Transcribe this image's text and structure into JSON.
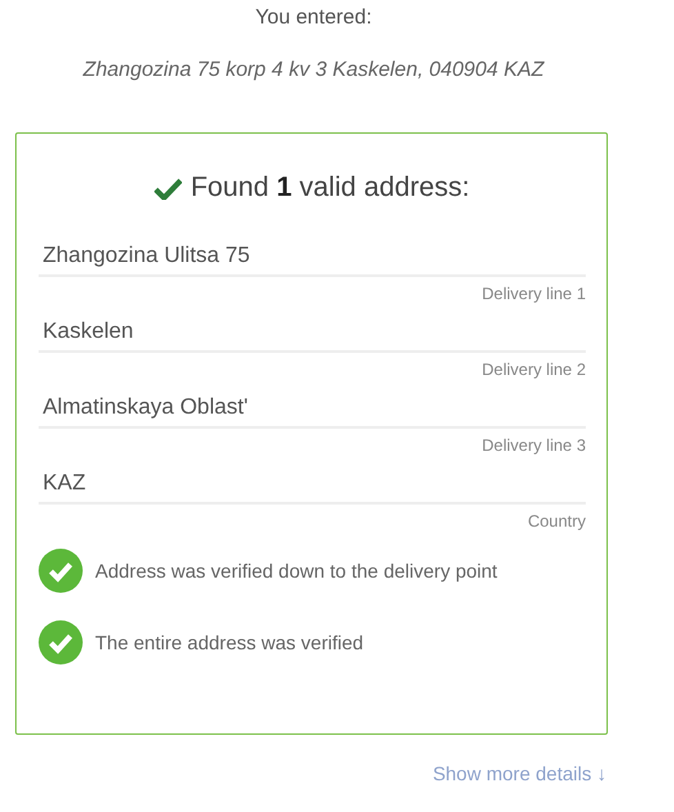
{
  "entered": {
    "heading": "You entered:",
    "address": "Zhangozina 75 korp 4 kv 3 Kaskelen, 040904 KAZ"
  },
  "result": {
    "title": "Found **1** valid address:",
    "fields": [
      {
        "value": "Zhangozina Ulitsa 75",
        "label": "Delivery line 1"
      },
      {
        "value": "Kaskelen",
        "label": "Delivery line 2"
      },
      {
        "value": "Almatinskaya Oblast'",
        "label": "Delivery line 3"
      },
      {
        "value": "KAZ",
        "label": "Country"
      }
    ],
    "checks": [
      "Address was verified down to the delivery point",
      "The entire address was verified"
    ]
  },
  "link": "Show more details ↓"
}
